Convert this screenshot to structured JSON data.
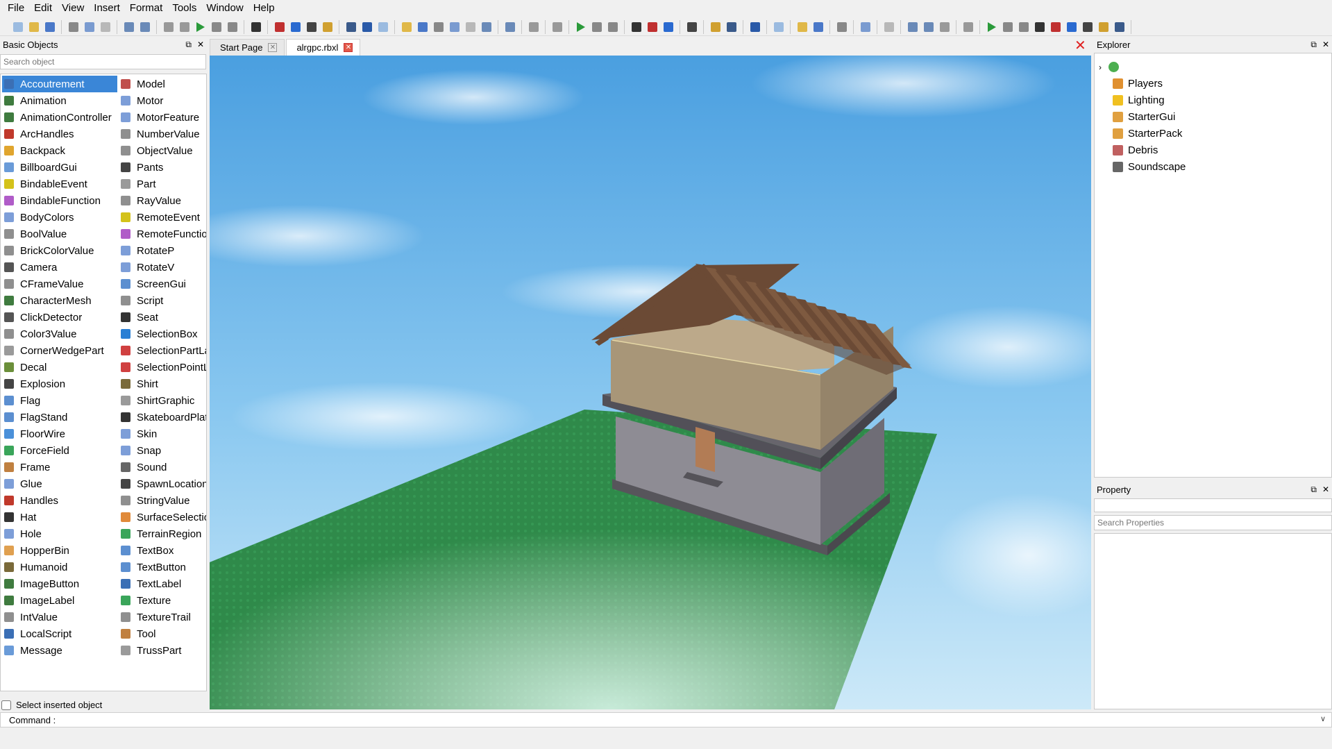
{
  "menu": [
    "File",
    "Edit",
    "View",
    "Insert",
    "Format",
    "Tools",
    "Window",
    "Help"
  ],
  "basic_objects": {
    "title": "Basic Objects",
    "search_placeholder": "Search object",
    "selected": "Accoutrement",
    "column1": [
      {
        "label": "Accoutrement",
        "icon": "accoutrement-icon",
        "color": "#3b6fb5"
      },
      {
        "label": "Animation",
        "icon": "animation-icon",
        "color": "#3f7b3f"
      },
      {
        "label": "AnimationController",
        "icon": "animation-controller-icon",
        "color": "#3f7b3f"
      },
      {
        "label": "ArcHandles",
        "icon": "arc-handles-icon",
        "color": "#c0392b"
      },
      {
        "label": "Backpack",
        "icon": "backpack-icon",
        "color": "#e0a52e"
      },
      {
        "label": "BillboardGui",
        "icon": "billboard-gui-icon",
        "color": "#6a9bd8"
      },
      {
        "label": "BindableEvent",
        "icon": "bindable-event-icon",
        "color": "#d4c21a"
      },
      {
        "label": "BindableFunction",
        "icon": "bindable-function-icon",
        "color": "#b05cc8"
      },
      {
        "label": "BodyColors",
        "icon": "body-colors-icon",
        "color": "#7d9ed8"
      },
      {
        "label": "BoolValue",
        "icon": "bool-value-icon",
        "color": "#8f8f8f"
      },
      {
        "label": "BrickColorValue",
        "icon": "brick-color-value-icon",
        "color": "#8f8f8f"
      },
      {
        "label": "Camera",
        "icon": "camera-icon",
        "color": "#555555"
      },
      {
        "label": "CFrameValue",
        "icon": "cframe-value-icon",
        "color": "#8f8f8f"
      },
      {
        "label": "CharacterMesh",
        "icon": "character-mesh-icon",
        "color": "#3f7b3f"
      },
      {
        "label": "ClickDetector",
        "icon": "click-detector-icon",
        "color": "#555555"
      },
      {
        "label": "Color3Value",
        "icon": "color3-value-icon",
        "color": "#8f8f8f"
      },
      {
        "label": "CornerWedgePart",
        "icon": "corner-wedge-part-icon",
        "color": "#9a9a9a"
      },
      {
        "label": "Decal",
        "icon": "decal-icon",
        "color": "#6b8f3a"
      },
      {
        "label": "Explosion",
        "icon": "explosion-icon",
        "color": "#444444"
      },
      {
        "label": "Flag",
        "icon": "flag-icon",
        "color": "#5c8fd0"
      },
      {
        "label": "FlagStand",
        "icon": "flag-stand-icon",
        "color": "#5c8fd0"
      },
      {
        "label": "FloorWire",
        "icon": "floor-wire-icon",
        "color": "#4a90d9"
      },
      {
        "label": "ForceField",
        "icon": "force-field-icon",
        "color": "#3aa55a"
      },
      {
        "label": "Frame",
        "icon": "frame-icon",
        "color": "#c08040"
      },
      {
        "label": "Glue",
        "icon": "glue-icon",
        "color": "#7d9ed8"
      },
      {
        "label": "Handles",
        "icon": "handles-icon",
        "color": "#c0392b"
      },
      {
        "label": "Hat",
        "icon": "hat-icon",
        "color": "#333333"
      },
      {
        "label": "Hole",
        "icon": "hole-icon",
        "color": "#7d9ed8"
      },
      {
        "label": "HopperBin",
        "icon": "hopper-bin-icon",
        "color": "#e0a050"
      },
      {
        "label": "Humanoid",
        "icon": "humanoid-icon",
        "color": "#7a6a3a"
      },
      {
        "label": "ImageButton",
        "icon": "image-button-icon",
        "color": "#3f7b3f"
      },
      {
        "label": "ImageLabel",
        "icon": "image-label-icon",
        "color": "#3f7b3f"
      },
      {
        "label": "IntValue",
        "icon": "int-value-icon",
        "color": "#8f8f8f"
      },
      {
        "label": "LocalScript",
        "icon": "local-script-icon",
        "color": "#3b6fb5"
      },
      {
        "label": "Message",
        "icon": "message-icon",
        "color": "#6a9bd8"
      }
    ],
    "column2": [
      {
        "label": "Model",
        "icon": "model-icon",
        "color": "#c0504d"
      },
      {
        "label": "Motor",
        "icon": "motor-icon",
        "color": "#7d9ed8"
      },
      {
        "label": "MotorFeature",
        "icon": "motor-feature-icon",
        "color": "#7d9ed8"
      },
      {
        "label": "NumberValue",
        "icon": "number-value-icon",
        "color": "#8f8f8f"
      },
      {
        "label": "ObjectValue",
        "icon": "object-value-icon",
        "color": "#8f8f8f"
      },
      {
        "label": "Pants",
        "icon": "pants-icon",
        "color": "#444444"
      },
      {
        "label": "Part",
        "icon": "part-icon",
        "color": "#9a9a9a"
      },
      {
        "label": "RayValue",
        "icon": "ray-value-icon",
        "color": "#8f8f8f"
      },
      {
        "label": "RemoteEvent",
        "icon": "remote-event-icon",
        "color": "#d4c21a"
      },
      {
        "label": "RemoteFunctio",
        "icon": "remote-function-icon",
        "color": "#b05cc8"
      },
      {
        "label": "RotateP",
        "icon": "rotate-p-icon",
        "color": "#7d9ed8"
      },
      {
        "label": "RotateV",
        "icon": "rotate-v-icon",
        "color": "#7d9ed8"
      },
      {
        "label": "ScreenGui",
        "icon": "screen-gui-icon",
        "color": "#5c8fd0"
      },
      {
        "label": "Script",
        "icon": "script-icon",
        "color": "#8f8f8f"
      },
      {
        "label": "Seat",
        "icon": "seat-icon",
        "color": "#333333"
      },
      {
        "label": "SelectionBox",
        "icon": "selection-box-icon",
        "color": "#2a7fd4"
      },
      {
        "label": "SelectionPartLa",
        "icon": "selection-part-lasso-icon",
        "color": "#d04040"
      },
      {
        "label": "SelectionPointL",
        "icon": "selection-point-lasso-icon",
        "color": "#d04040"
      },
      {
        "label": "Shirt",
        "icon": "shirt-icon",
        "color": "#7a6a3a"
      },
      {
        "label": "ShirtGraphic",
        "icon": "shirt-graphic-icon",
        "color": "#9a9a9a"
      },
      {
        "label": "SkateboardPlat",
        "icon": "skateboard-platform-icon",
        "color": "#333333"
      },
      {
        "label": "Skin",
        "icon": "skin-icon",
        "color": "#7d9ed8"
      },
      {
        "label": "Snap",
        "icon": "snap-icon",
        "color": "#7d9ed8"
      },
      {
        "label": "Sound",
        "icon": "sound-icon",
        "color": "#666666"
      },
      {
        "label": "SpawnLocation",
        "icon": "spawn-location-icon",
        "color": "#444444"
      },
      {
        "label": "StringValue",
        "icon": "string-value-icon",
        "color": "#8f8f8f"
      },
      {
        "label": "SurfaceSelectio",
        "icon": "surface-selection-icon",
        "color": "#e08a3a"
      },
      {
        "label": "TerrainRegion",
        "icon": "terrain-region-icon",
        "color": "#3aa55a"
      },
      {
        "label": "TextBox",
        "icon": "text-box-icon",
        "color": "#5c8fd0"
      },
      {
        "label": "TextButton",
        "icon": "text-button-icon",
        "color": "#5c8fd0"
      },
      {
        "label": "TextLabel",
        "icon": "text-label-icon",
        "color": "#3b6fb5"
      },
      {
        "label": "Texture",
        "icon": "texture-icon",
        "color": "#3aa55a"
      },
      {
        "label": "TextureTrail",
        "icon": "texture-trail-icon",
        "color": "#8f8f8f"
      },
      {
        "label": "Tool",
        "icon": "tool-icon",
        "color": "#c08040"
      },
      {
        "label": "TrussPart",
        "icon": "truss-part-icon",
        "color": "#9a9a9a"
      }
    ],
    "select_inserted_label": "Select inserted object",
    "select_inserted_checked": false
  },
  "command": {
    "label": "Command :",
    "value": ""
  },
  "tabs": [
    {
      "label": "Start Page",
      "active": false
    },
    {
      "label": "alrgpc.rbxl",
      "active": true
    }
  ],
  "explorer": {
    "title": "Explorer",
    "items": [
      {
        "label": "Players",
        "icon": "players-icon",
        "color": "#e09030"
      },
      {
        "label": "Lighting",
        "icon": "lighting-icon",
        "color": "#f0c020"
      },
      {
        "label": "StarterGui",
        "icon": "starter-gui-icon",
        "color": "#e0a040"
      },
      {
        "label": "StarterPack",
        "icon": "starter-pack-icon",
        "color": "#e0a040"
      },
      {
        "label": "Debris",
        "icon": "debris-icon",
        "color": "#c06060"
      },
      {
        "label": "Soundscape",
        "icon": "soundscape-icon",
        "color": "#666666"
      }
    ]
  },
  "property": {
    "title": "Property",
    "search_placeholder": "Search Properties"
  },
  "colors": {
    "selection": "#3a86d7",
    "sky_top": "#4a9fe0",
    "sky_bottom": "#cde9f8",
    "baseplate": "#2f8a4a",
    "roof": "#6b4a35",
    "walls": "#a89678",
    "foundation": "#67656c",
    "door": "#b27c55"
  },
  "toolbar_icons": [
    "new-file-icon",
    "open-folder-icon",
    "save-icon",
    "cut-icon",
    "copy-icon",
    "paste-icon",
    "undo-icon",
    "redo-icon",
    "group-icon",
    "ungroup-icon",
    "play-icon",
    "pause-icon",
    "stop-icon",
    "select-icon",
    "move-icon",
    "scale-icon",
    "rotate-icon",
    "lock-icon",
    "anchor-icon",
    "paint-icon"
  ]
}
